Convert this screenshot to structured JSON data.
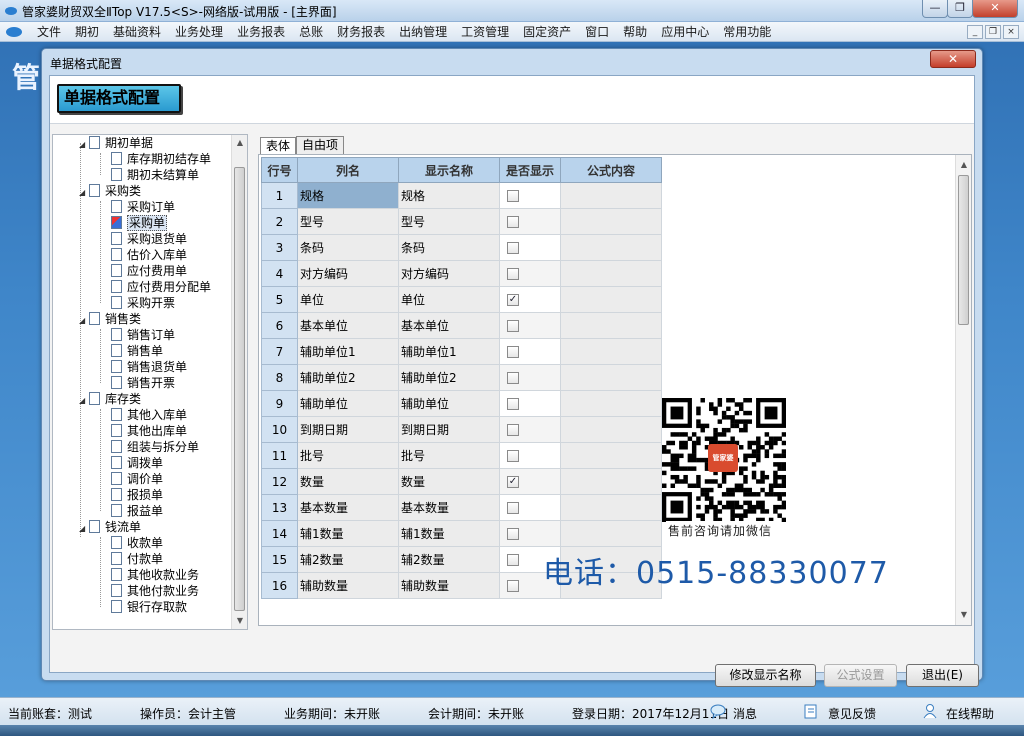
{
  "window": {
    "title": "管家婆财贸双全ⅡTop V17.5<S>-网络版-试用版 - [主界面]",
    "buttons": {
      "minimize": "—",
      "maximize": "❐",
      "close": "✕"
    }
  },
  "menubar": {
    "items": [
      "文件",
      "期初",
      "基础资料",
      "业务处理",
      "业务报表",
      "总账",
      "财务报表",
      "出纳管理",
      "工资管理",
      "固定资产",
      "窗口",
      "帮助",
      "应用中心",
      "常用功能"
    ],
    "mdi": {
      "minimize": "_",
      "restore": "❐",
      "close": "×"
    }
  },
  "background_logo": "管",
  "dialog": {
    "title": "单据格式配置",
    "close": "✕",
    "section_title": "单据格式配置"
  },
  "tree": {
    "groups": [
      {
        "label": "期初单据",
        "items": [
          "库存期初结存单",
          "期初未结算单"
        ]
      },
      {
        "label": "采购类",
        "items": [
          "采购订单",
          "采购单",
          "采购退货单",
          "估价入库单",
          "应付费用单",
          "应付费用分配单",
          "采购开票"
        ]
      },
      {
        "label": "销售类",
        "items": [
          "销售订单",
          "销售单",
          "销售退货单",
          "销售开票"
        ]
      },
      {
        "label": "库存类",
        "items": [
          "其他入库单",
          "其他出库单",
          "组装与拆分单",
          "调拨单",
          "调价单",
          "报损单",
          "报益单"
        ]
      },
      {
        "label": "钱流单",
        "items": [
          "收款单",
          "付款单",
          "其他收款业务",
          "其他付款业务",
          "银行存取款"
        ]
      }
    ],
    "selected": "采购单"
  },
  "tabs": [
    "表体",
    "自由项"
  ],
  "grid": {
    "headers": [
      "行号",
      "列名",
      "显示名称",
      "是否显示",
      "公式内容"
    ],
    "rows": [
      {
        "no": "1",
        "name": "规格",
        "display": "规格",
        "show": false
      },
      {
        "no": "2",
        "name": "型号",
        "display": "型号",
        "show": false
      },
      {
        "no": "3",
        "name": "条码",
        "display": "条码",
        "show": false
      },
      {
        "no": "4",
        "name": "对方编码",
        "display": "对方编码",
        "show": false
      },
      {
        "no": "5",
        "name": "单位",
        "display": "单位",
        "show": true
      },
      {
        "no": "6",
        "name": "基本单位",
        "display": "基本单位",
        "show": false
      },
      {
        "no": "7",
        "name": "辅助单位1",
        "display": "辅助单位1",
        "show": false
      },
      {
        "no": "8",
        "name": "辅助单位2",
        "display": "辅助单位2",
        "show": false
      },
      {
        "no": "9",
        "name": "辅助单位",
        "display": "辅助单位",
        "show": false
      },
      {
        "no": "10",
        "name": "到期日期",
        "display": "到期日期",
        "show": false
      },
      {
        "no": "11",
        "name": "批号",
        "display": "批号",
        "show": false
      },
      {
        "no": "12",
        "name": "数量",
        "display": "数量",
        "show": true
      },
      {
        "no": "13",
        "name": "基本数量",
        "display": "基本数量",
        "show": false
      },
      {
        "no": "14",
        "name": "辅1数量",
        "display": "辅1数量",
        "show": false
      },
      {
        "no": "15",
        "name": "辅2数量",
        "display": "辅2数量",
        "show": false
      },
      {
        "no": "16",
        "name": "辅助数量",
        "display": "辅助数量",
        "show": false
      }
    ]
  },
  "buttons": {
    "rename": "修改显示名称",
    "formula": "公式设置",
    "exit": "退出(E)"
  },
  "promo": {
    "qr_badge": "管家婆",
    "caption": "售前咨询请加微信",
    "phone": "电话：0515-88330077"
  },
  "statusbar": {
    "account": "当前账套：测试",
    "operator": "操作员：会计主管",
    "biz_period": "业务期间：未开账",
    "acc_period": "会计期间：未开账",
    "login_date": "登录日期：2017年12月11日",
    "message": "消息",
    "feedback": "意见反馈",
    "help": "在线帮助"
  },
  "colors": {
    "accent": "#2a9ad0",
    "grid_header": "#b9d3ec",
    "phone_text": "#1e5aa8"
  }
}
